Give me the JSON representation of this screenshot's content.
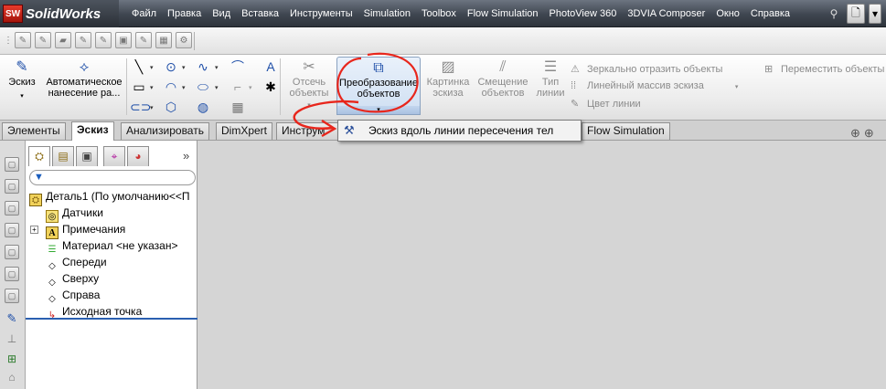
{
  "app": {
    "name": "SolidWorks",
    "logo_mark": "SW"
  },
  "menu": [
    "Файл",
    "Правка",
    "Вид",
    "Вставка",
    "Инструменты",
    "Simulation",
    "Toolbox",
    "Flow Simulation",
    "PhotoView 360",
    "3DVIA Composer",
    "Окно",
    "Справка"
  ],
  "command_manager": {
    "sketch": "Эскиз",
    "smart_dimension_l1": "Автоматическое",
    "smart_dimension_l2": "нанесение ра...",
    "trim_l1": "Отсечь",
    "trim_l2": "объекты",
    "convert_l1": "Преобразование",
    "convert_l2": "объектов",
    "sketch_picture_l1": "Картинка",
    "sketch_picture_l2": "эскиза",
    "offset_l1": "Смещение",
    "offset_l2": "объектов",
    "line_type_l1": "Тип",
    "line_type_l2": "линии",
    "mirror": "Зеркально отразить объекты",
    "linear_pattern": "Линейный массив эскиза",
    "line_color": "Цвет линии",
    "move": "Переместить объекты"
  },
  "tabs": [
    {
      "label": "Элементы",
      "active": false
    },
    {
      "label": "Эскиз",
      "active": true
    },
    {
      "label": "Анализировать",
      "active": false
    },
    {
      "label": "DimXpert",
      "active": false
    },
    {
      "label": "Инструм",
      "active": false
    },
    {
      "label": "Flow Simulation",
      "active": false
    }
  ],
  "flyout": {
    "label": "Эскиз вдоль линии пересечения тел"
  },
  "feature_tree": {
    "expand_glyph": "»",
    "root": "Деталь1  (По умолчанию<<П",
    "items": [
      "Датчики",
      "Примечания",
      "Материал <не указан>",
      "Спереди",
      "Сверху",
      "Справа",
      "Исходная точка"
    ]
  },
  "colors": {
    "accent": "#2a5fb0",
    "annotation": "#e8261c",
    "title_bar": "#3f4650"
  }
}
